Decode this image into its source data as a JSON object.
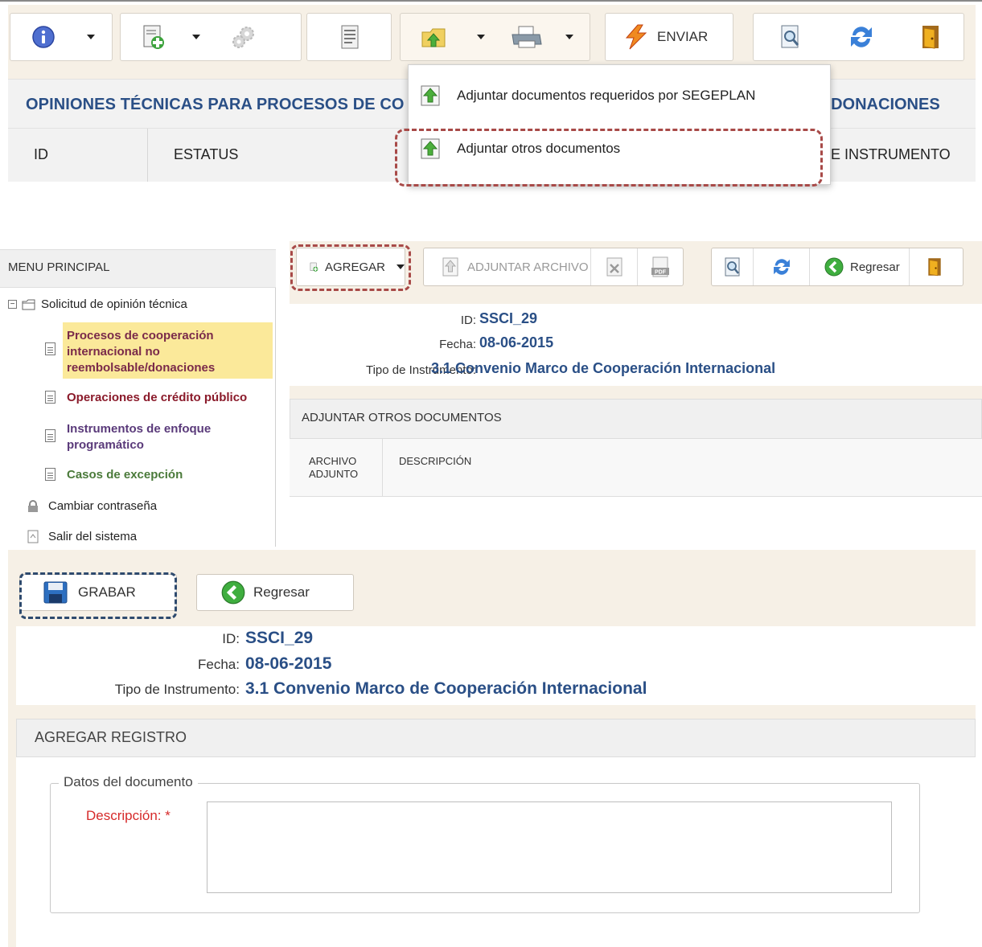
{
  "panel1": {
    "toolbar": {
      "info_icon": "info-icon",
      "new_icon": "new-document-icon",
      "settings_icon": "gear-icon",
      "list_icon": "document-list-icon",
      "attach_icon": "folder-upload-icon",
      "print_icon": "printer-icon",
      "send_label": "ENVIAR",
      "preview_icon": "preview-icon",
      "refresh_icon": "refresh-icon",
      "exit_icon": "exit-door-icon"
    },
    "title": "OPINIONES TÉCNICAS PARA PROCESOS DE CO",
    "title_right": "/ DONACIONES",
    "columns": {
      "id": "ID",
      "status": "ESTATUS",
      "instrument": "DE INSTRUMENTO"
    },
    "dropdown": [
      {
        "label": "Adjuntar documentos requeridos por SEGEPLAN"
      },
      {
        "label": "Adjuntar otros documentos"
      }
    ]
  },
  "panel2": {
    "menu": {
      "header": "MENU PRINCIPAL",
      "root": "Solicitud de opinión técnica",
      "items": [
        {
          "label": "Procesos de cooperación internacional no reembolsable/donaciones",
          "color": "#7a2a4a"
        },
        {
          "label": "Operaciones de crédito público",
          "color": "#8a1a2a"
        },
        {
          "label": "Instrumentos de enfoque programático",
          "color": "#5a3a7a"
        },
        {
          "label": "Casos de excepción",
          "color": "#4a7a3a"
        }
      ],
      "change_password": "Cambiar contraseña",
      "logout": "Salir del sistema"
    },
    "toolbar": {
      "add_label": "AGREGAR",
      "attach_label": "ADJUNTAR ARCHIVO",
      "back_label": "Regresar"
    },
    "info": {
      "id_label": "ID:",
      "id_value": "SSCI_29",
      "date_label": "Fecha:",
      "date_value": "08-06-2015",
      "type_label": "Tipo de Instrumento:",
      "type_value": "3.1 Convenio Marco de Cooperación Internacional"
    },
    "section_title": "ADJUNTAR OTROS DOCUMENTOS",
    "columns": {
      "file_line1": "ARCHIVO",
      "file_line2": "ADJUNTO",
      "description": "DESCRIPCIÓN"
    }
  },
  "panel3": {
    "toolbar": {
      "save_label": "GRABAR",
      "back_label": "Regresar"
    },
    "info": {
      "id_label": "ID:",
      "id_value": "SSCI_29",
      "date_label": "Fecha:",
      "date_value": "08-06-2015",
      "type_label": "Tipo de Instrumento:",
      "type_value": "3.1 Convenio Marco de Cooperación Internacional"
    },
    "section_title": "AGREGAR REGISTRO",
    "fieldset_legend": "Datos del documento",
    "description_label": "Descripción: *",
    "description_value": ""
  },
  "colors": {
    "accent_blue": "#2a4f86",
    "highlight_red": "#a84a48",
    "highlight_blue": "#2e4a6e",
    "panel_bg": "#f6f0e6"
  }
}
